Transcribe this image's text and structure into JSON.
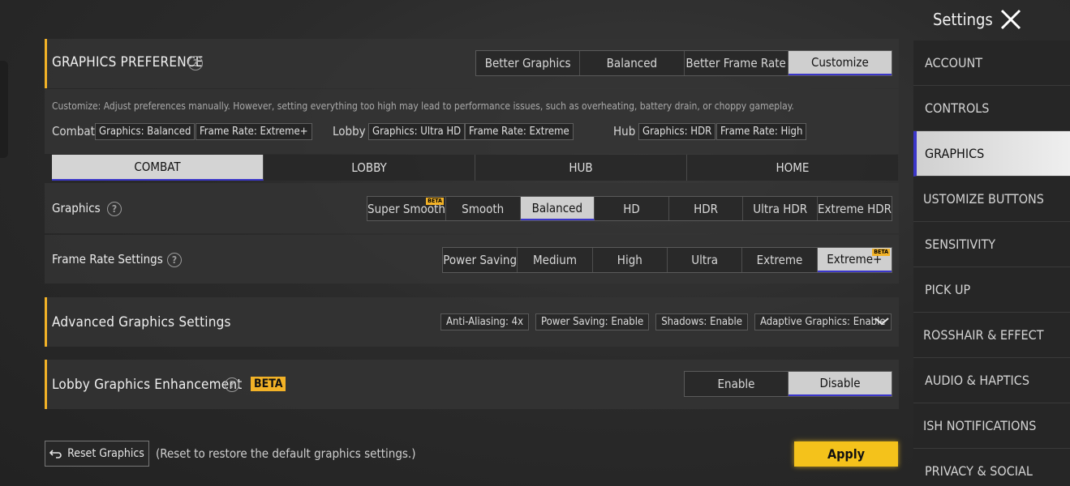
{
  "header": {
    "title": "Settings"
  },
  "sidebar": {
    "items": [
      {
        "label": "ACCOUNT"
      },
      {
        "label": "CONTROLS"
      },
      {
        "label": "GRAPHICS"
      },
      {
        "label": "USTOMIZE BUTTONS"
      },
      {
        "label": "SENSITIVITY"
      },
      {
        "label": "PICK UP"
      },
      {
        "label": "ROSSHAIR & EFFECT"
      },
      {
        "label": "AUDIO & HAPTICS"
      },
      {
        "label": "ISH NOTIFICATIONS"
      },
      {
        "label": "PRIVACY & SOCIAL"
      }
    ],
    "selected": "GRAPHICS"
  },
  "preference": {
    "title": "GRAPHICS PREFERENCE",
    "options": [
      "Better Graphics",
      "Balanced",
      "Better Frame Rate",
      "Customize"
    ],
    "selected": "Customize",
    "description": "Customize: Adjust preferences manually. However, setting everything too high may lead to performance issues, such as overheating, battery drain, or choppy gameplay.",
    "combat": {
      "label": "Combat",
      "graphics": "Graphics: Balanced",
      "framerate": "Frame Rate: Extreme+"
    },
    "lobby": {
      "label": "Lobby",
      "graphics": "Graphics: Ultra HD",
      "framerate": "Frame Rate: Extreme"
    },
    "hub": {
      "label": "Hub",
      "graphics": "Graphics: HDR",
      "framerate": "Frame Rate: High"
    }
  },
  "mode_tabs": {
    "items": [
      "COMBAT",
      "LOBBY",
      "HUB",
      "HOME"
    ],
    "selected": "COMBAT"
  },
  "graphics": {
    "label": "Graphics",
    "options": [
      "Super Smooth",
      "Smooth",
      "Balanced",
      "HD",
      "HDR",
      "Ultra HDR",
      "Extreme HDR"
    ],
    "selected": "Balanced",
    "beta_option": "Super Smooth"
  },
  "frame_rate": {
    "label": "Frame Rate Settings",
    "options": [
      "Power Saving",
      "Medium",
      "High",
      "Ultra",
      "Extreme",
      "Extreme+"
    ],
    "selected": "Extreme+",
    "beta_option": "Extreme+"
  },
  "beta_text": "BETA",
  "advanced": {
    "title": "Advanced Graphics Settings",
    "chips": [
      "Anti-Aliasing: 4x",
      "Power Saving: Enable",
      "Shadows: Enable",
      "Adaptive Graphics: Enable"
    ]
  },
  "lobby_enh": {
    "title": "Lobby Graphics Enhancement",
    "options": [
      "Enable",
      "Disable"
    ],
    "selected": "Disable"
  },
  "footer": {
    "reset_label": "Reset Graphics",
    "reset_hint": "(Reset to restore the default graphics settings.)",
    "apply_label": "Apply"
  },
  "colors": {
    "accent": "#f2b227",
    "apply": "#f4c21b",
    "selected_underline": "#3b36c9"
  }
}
